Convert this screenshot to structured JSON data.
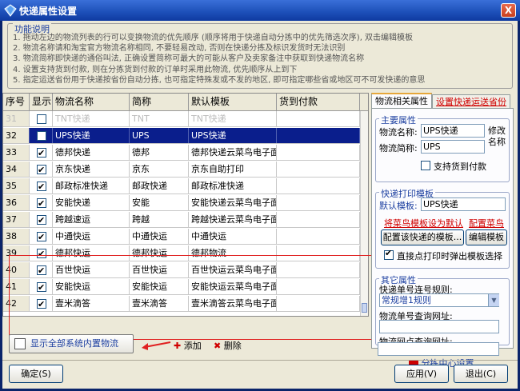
{
  "window": {
    "title": "快递属性设置",
    "close": "X"
  },
  "func": {
    "legend": "功能说明",
    "lines": [
      "1. 拖动左边的物流列表的行可以变换物流的优先顺序 (顺序将用于快递自动分拣中的优先筛选次序), 双击编辑模板",
      "2. 物流名称请和淘宝官方物流名称相同, 不要轻易改动, 否则在快递分拣及标识发货时无法识别",
      "3. 物流简称即快递的通俗叫法, 正确设置简称可最大的可能从客户及卖家备注中获取到快递物流名称",
      "4. 设置支持货到付款, 则在分拣货到付款的订单时采用此物流, 优先顺序从上到下",
      "5. 指定运送省份用于快递按省份自动分拣, 也可指定特殊发或不发的地区, 即可指定哪些省或地区可不可发快递的意思"
    ]
  },
  "grid": {
    "headers": [
      "序号",
      "显示",
      "物流名称",
      "简称",
      "默认模板",
      "货到付款"
    ],
    "rows": [
      {
        "seq": "31",
        "show": false,
        "name": "TNT快递",
        "abbr": "TNT",
        "tpl": "TNT快递",
        "cod": "",
        "state": "gray"
      },
      {
        "seq": "32",
        "show": false,
        "name": "UPS快递",
        "abbr": "UPS",
        "tpl": "UPS快递",
        "cod": "",
        "state": "sel"
      },
      {
        "seq": "33",
        "show": true,
        "name": "德邦快递",
        "abbr": "德邦",
        "tpl": "德邦快递云菜鸟电子面单",
        "cod": "",
        "state": ""
      },
      {
        "seq": "34",
        "show": true,
        "name": "京东快递",
        "abbr": "京东",
        "tpl": "京东自助打印",
        "cod": "",
        "state": ""
      },
      {
        "seq": "35",
        "show": true,
        "name": "邮政标准快递",
        "abbr": "邮政快递",
        "tpl": "邮政标准快递",
        "cod": "",
        "state": ""
      },
      {
        "seq": "36",
        "show": true,
        "name": "安能快递",
        "abbr": "安能",
        "tpl": "安能快递云菜鸟电子面单",
        "cod": "",
        "state": ""
      },
      {
        "seq": "37",
        "show": true,
        "name": "跨越速运",
        "abbr": "跨越",
        "tpl": "跨越快递云菜鸟电子面单",
        "cod": "",
        "state": ""
      },
      {
        "seq": "38",
        "show": true,
        "name": "中通快运",
        "abbr": "中通快运",
        "tpl": "中通快运",
        "cod": "",
        "state": ""
      },
      {
        "seq": "39",
        "show": true,
        "name": "德邦快运",
        "abbr": "德邦快运",
        "tpl": "德邦物流",
        "cod": "",
        "state": ""
      },
      {
        "seq": "40",
        "show": true,
        "name": "百世快运",
        "abbr": "百世快运",
        "tpl": "百世快运云菜鸟电子面单",
        "cod": "",
        "state": ""
      },
      {
        "seq": "41",
        "show": true,
        "name": "安能快运",
        "abbr": "安能快运",
        "tpl": "安能快运云菜鸟电子面单",
        "cod": "",
        "state": ""
      },
      {
        "seq": "42",
        "show": true,
        "name": "壹米滴答",
        "abbr": "壹米滴答",
        "tpl": "壹米滴答云菜鸟电子面单",
        "cod": "",
        "state": ""
      }
    ]
  },
  "tabs": {
    "active": "物流相关属性",
    "other": "设置快递运送省份"
  },
  "main_props": {
    "title": "主要属性",
    "name_label": "物流名称:",
    "name_value": "UPS快递",
    "abbr_label": "物流简称:",
    "abbr_value": "UPS",
    "edit_hint": "修改名称",
    "cod_label": "支持货到付款"
  },
  "print_tpl": {
    "title": "快递打印模板",
    "default_label": "默认模板:",
    "default_value": "UPS快递",
    "link_default": "将菜鸟模板设为默认",
    "link_cainiao": "配置菜鸟",
    "cfg_btn": "配置该快递的模板...",
    "edit_btn": "编辑模板",
    "direct_print": "直接点打印时弹出模板选择"
  },
  "other_props": {
    "title": "其它属性",
    "rule_label": "快递单号连号规则:",
    "rule_value": "常规增1规则",
    "query_label": "物流单号查询网址:",
    "query_value": "",
    "site_label": "物流网点查询网址:",
    "site_value": "",
    "dispatch": "分拣中心设置"
  },
  "bottom": {
    "show_all": "显示全部系统内置物流",
    "add": "添加",
    "del": "删除"
  },
  "footer": {
    "ok": "确定(S)",
    "apply": "应用(V)",
    "exit": "退出(C)"
  }
}
